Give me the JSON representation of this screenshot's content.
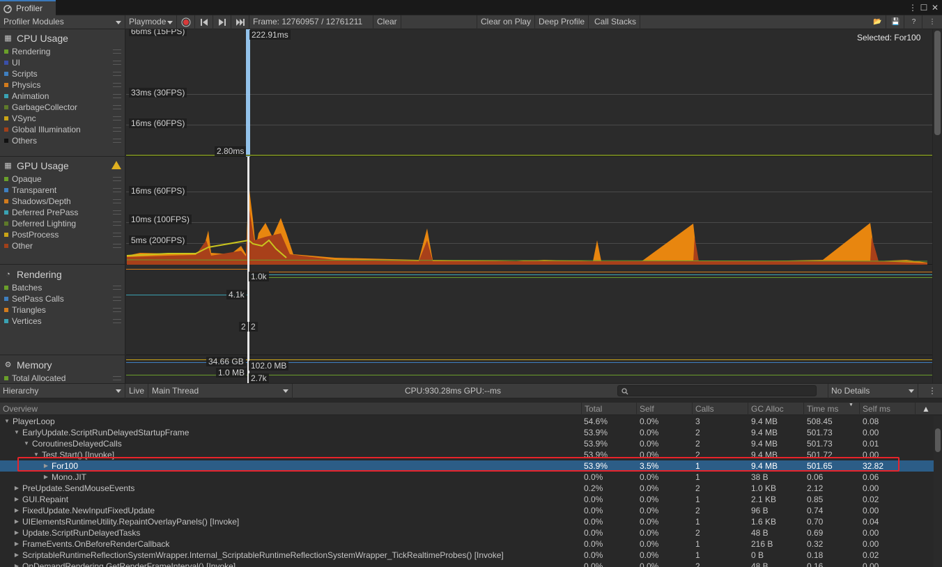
{
  "window": {
    "tab_title": "Profiler",
    "menu_icon": "kebab-menu-icon",
    "maximize_icon": "maximize-icon",
    "close_icon": "close-icon"
  },
  "toolbar": {
    "modules_dropdown": "Profiler Modules",
    "target_dropdown": "Playmode",
    "frame_label": "Frame: 12760957 / 12761211",
    "clear": "Clear",
    "clear_on_play": "Clear on Play",
    "deep_profile": "Deep Profile",
    "call_stacks": "Call Stacks"
  },
  "modules": {
    "cpu": {
      "title": "CPU Usage",
      "items": [
        {
          "label": "Rendering",
          "color": "#6a9f2a"
        },
        {
          "label": "UI",
          "color": "#3a4fa8"
        },
        {
          "label": "Scripts",
          "color": "#3f7fbf"
        },
        {
          "label": "Physics",
          "color": "#d27b1d"
        },
        {
          "label": "Animation",
          "color": "#3aa2b3"
        },
        {
          "label": "GarbageCollector",
          "color": "#5e7a2a"
        },
        {
          "label": "VSync",
          "color": "#c9a417"
        },
        {
          "label": "Global Illumination",
          "color": "#a0401a"
        },
        {
          "label": "Others",
          "color": "#111111"
        }
      ]
    },
    "gpu": {
      "title": "GPU Usage",
      "items": [
        {
          "label": "Opaque",
          "color": "#6a9f2a"
        },
        {
          "label": "Transparent",
          "color": "#3f7fbf"
        },
        {
          "label": "Shadows/Depth",
          "color": "#d27b1d"
        },
        {
          "label": "Deferred PrePass",
          "color": "#3aa2b3"
        },
        {
          "label": "Deferred Lighting",
          "color": "#5e7a2a"
        },
        {
          "label": "PostProcess",
          "color": "#c9a417"
        },
        {
          "label": "Other",
          "color": "#a0401a"
        }
      ]
    },
    "rendering": {
      "title": "Rendering",
      "items": [
        {
          "label": "Batches",
          "color": "#6a9f2a"
        },
        {
          "label": "SetPass Calls",
          "color": "#3f7fbf"
        },
        {
          "label": "Triangles",
          "color": "#d27b1d"
        },
        {
          "label": "Vertices",
          "color": "#3aa2b3"
        }
      ]
    },
    "memory": {
      "title": "Memory",
      "items": [
        {
          "label": "Total Allocated",
          "color": "#6a9f2a"
        }
      ]
    }
  },
  "charts": {
    "cpu": {
      "top_label": "66ms (15FPS)",
      "line_33": "33ms (30FPS)",
      "line_16": "16ms (60FPS)",
      "selected_value": "222.91ms",
      "marker_value": "2.80ms",
      "selected_text": "Selected: For100"
    },
    "gpu": {
      "line_16": "16ms (60FPS)",
      "line_10": "10ms (100FPS)",
      "line_5": "5ms (200FPS)"
    },
    "rendering": {
      "label_a": "1.0k",
      "label_b": "4.1k",
      "label_c": "2",
      "label_d": "2"
    },
    "memory": {
      "label_a": "34.66 GB",
      "label_b": "102.0 MB",
      "label_c": "1.0 MB",
      "label_d": "2.7k"
    }
  },
  "bottom": {
    "view_dropdown": "Hierarchy",
    "live": "Live",
    "thread_dropdown": "Main Thread",
    "cpu_gpu": "CPU:930.28ms   GPU:--ms",
    "details_dropdown": "No Details"
  },
  "table": {
    "columns": [
      "Overview",
      "Total",
      "Self",
      "Calls",
      "GC Alloc",
      "Time ms",
      "Self ms"
    ],
    "rows": [
      {
        "indent": 0,
        "toggle": "open",
        "name": "PlayerLoop",
        "total": "54.6%",
        "self": "0.0%",
        "calls": "3",
        "gc": "9.4 MB",
        "time": "508.45",
        "selfms": "0.08"
      },
      {
        "indent": 1,
        "toggle": "open",
        "name": "EarlyUpdate.ScriptRunDelayedStartupFrame",
        "total": "53.9%",
        "self": "0.0%",
        "calls": "2",
        "gc": "9.4 MB",
        "time": "501.73",
        "selfms": "0.00"
      },
      {
        "indent": 2,
        "toggle": "open",
        "name": "CoroutinesDelayedCalls",
        "total": "53.9%",
        "self": "0.0%",
        "calls": "2",
        "gc": "9.4 MB",
        "time": "501.73",
        "selfms": "0.01"
      },
      {
        "indent": 3,
        "toggle": "open",
        "name": "Test.Start() [Invoke]",
        "total": "53.9%",
        "self": "0.0%",
        "calls": "2",
        "gc": "9.4 MB",
        "time": "501.72",
        "selfms": "0.00"
      },
      {
        "indent": 4,
        "toggle": "closed",
        "name": "For100",
        "total": "53.9%",
        "self": "3.5%",
        "calls": "1",
        "gc": "9.4 MB",
        "time": "501.65",
        "selfms": "32.82",
        "selected": true
      },
      {
        "indent": 4,
        "toggle": "closed",
        "name": "Mono.JIT",
        "total": "0.0%",
        "self": "0.0%",
        "calls": "1",
        "gc": "38 B",
        "time": "0.06",
        "selfms": "0.06"
      },
      {
        "indent": 1,
        "toggle": "closed",
        "name": "PreUpdate.SendMouseEvents",
        "total": "0.2%",
        "self": "0.0%",
        "calls": "2",
        "gc": "1.0 KB",
        "time": "2.12",
        "selfms": "0.00"
      },
      {
        "indent": 1,
        "toggle": "closed",
        "name": "GUI.Repaint",
        "total": "0.0%",
        "self": "0.0%",
        "calls": "1",
        "gc": "2.1 KB",
        "time": "0.85",
        "selfms": "0.02"
      },
      {
        "indent": 1,
        "toggle": "closed",
        "name": "FixedUpdate.NewInputFixedUpdate",
        "total": "0.0%",
        "self": "0.0%",
        "calls": "2",
        "gc": "96 B",
        "time": "0.74",
        "selfms": "0.00"
      },
      {
        "indent": 1,
        "toggle": "closed",
        "name": "UIElementsRuntimeUtility.RepaintOverlayPanels() [Invoke]",
        "total": "0.0%",
        "self": "0.0%",
        "calls": "1",
        "gc": "1.6 KB",
        "time": "0.70",
        "selfms": "0.04"
      },
      {
        "indent": 1,
        "toggle": "closed",
        "name": "Update.ScriptRunDelayedTasks",
        "total": "0.0%",
        "self": "0.0%",
        "calls": "2",
        "gc": "48 B",
        "time": "0.69",
        "selfms": "0.00"
      },
      {
        "indent": 1,
        "toggle": "closed",
        "name": "FrameEvents.OnBeforeRenderCallback",
        "total": "0.0%",
        "self": "0.0%",
        "calls": "1",
        "gc": "216 B",
        "time": "0.32",
        "selfms": "0.00"
      },
      {
        "indent": 1,
        "toggle": "closed",
        "name": "ScriptableRuntimeReflectionSystemWrapper.Internal_ScriptableRuntimeReflectionSystemWrapper_TickRealtimeProbes() [Invoke]",
        "total": "0.0%",
        "self": "0.0%",
        "calls": "1",
        "gc": "0 B",
        "time": "0.18",
        "selfms": "0.02"
      },
      {
        "indent": 1,
        "toggle": "closed",
        "name": "OnDemandRendering.GetRenderFrameInterval() [Invoke]",
        "total": "0.0%",
        "self": "0.0%",
        "calls": "2",
        "gc": "48 B",
        "time": "0.16",
        "selfms": "0.00"
      }
    ]
  }
}
